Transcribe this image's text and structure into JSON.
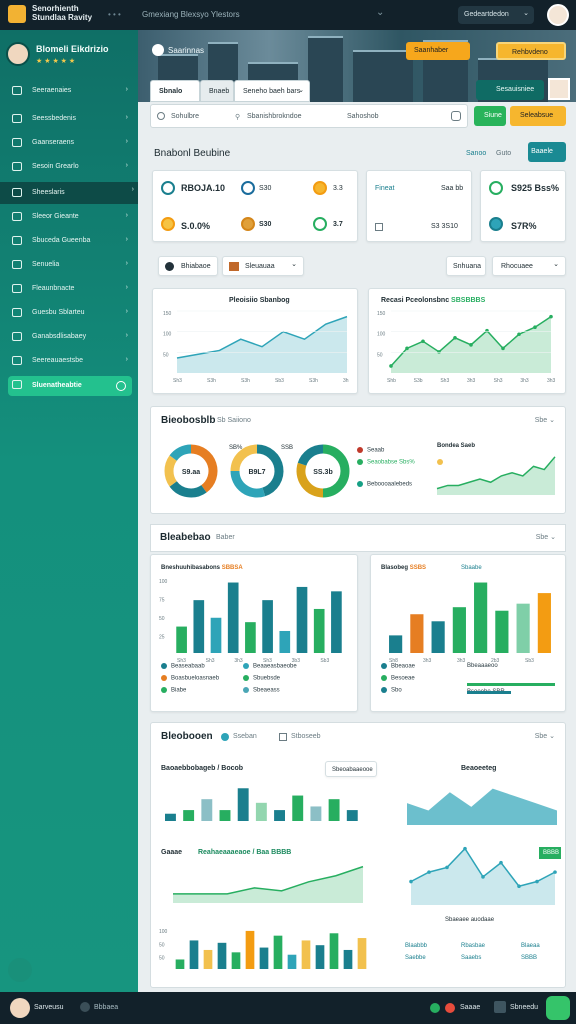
{
  "topbar": {
    "brand_line1": "Senorhienth",
    "brand_line2": "Stundlaa Ravity",
    "dots": "• • •",
    "nav_text": "Gmexiang Blexsyo Ylestors",
    "select_value": "Gedeartdedon",
    "chevron": "⌄"
  },
  "sidebar": {
    "profile_name": "Blomeli Eikdrizio",
    "profile_stars": "★ ★ ★ ★ ★",
    "items": [
      {
        "label": "Seeraenaies"
      },
      {
        "label": "Seessbedenis"
      },
      {
        "label": "Gaanseraens"
      },
      {
        "label": "Sesoin Grearlo"
      },
      {
        "label": "Sheeslaris"
      },
      {
        "label": "Sleeor Gieante"
      },
      {
        "label": "Sbuceda Gueenba"
      },
      {
        "label": "Senuelia"
      },
      {
        "label": "Fleaunbnacte"
      },
      {
        "label": "Guesbu Sblarteu"
      },
      {
        "label": "Ganabsdlisabaey"
      },
      {
        "label": "Seereauaestsbe"
      },
      {
        "label": "Sluenatheabtie"
      }
    ]
  },
  "hero": {
    "title": "Saarinnas",
    "btn1": "Saanhaber",
    "btn2": "Rehbvdeno",
    "btn3": "Sesauisniee"
  },
  "tabs": [
    {
      "label": "Sbnalo"
    },
    {
      "label": "Bnaeb"
    },
    {
      "label": "Seneho baeh bars"
    }
  ],
  "filters": {
    "f1": "Sohulbre",
    "f2": "Sbanishbrokndoe",
    "f3": "Sahoshob",
    "btn_green": "Siune",
    "btn_orange": "Seleabsue"
  },
  "overview": {
    "title": "Bnabonl Beubine",
    "links": [
      "Sanoo",
      "Guto"
    ],
    "button": "Baaele"
  },
  "kpis": [
    {
      "value": "RBOJA.10",
      "tag": "S30",
      "v2": "3.3"
    },
    {
      "value": "S.0.0%",
      "tag": "S30",
      "v2": "3.7"
    }
  ],
  "kpi_card2": {
    "label": "Fineat",
    "v1": "Saa bb",
    "v2": "S3 3S10"
  },
  "kpi_card3": {
    "v1": "S925 Bss%",
    "v2": "S7R%"
  },
  "controls": {
    "c1": "Bhiabaoe",
    "c2": "Sleuauaa",
    "c3": "Snhuana",
    "c4": "Rhocuaee"
  },
  "line_panel_left": {
    "title": "Pleoisiio Sbanbog"
  },
  "line_panel_right": {
    "title": "Recasi Pceolonsbnc",
    "accent": "SBSBBBS"
  },
  "section_donuts": {
    "title": "Bieobosblb",
    "sub": "Sb Saiiono",
    "dd": "Sbe ⌄",
    "donuts": [
      {
        "label": "S9.aa"
      },
      {
        "label": "B9L7"
      },
      {
        "label": "SS.3b"
      }
    ],
    "tags": [
      "SB%",
      "SSB"
    ],
    "legend": [
      {
        "label": "Seaab",
        "color": "#c0392b"
      },
      {
        "label": "Seaobabse Sbs%",
        "color": "#27ae60"
      },
      {
        "label": "Beboooaalebeds",
        "color": "#16a085"
      }
    ],
    "minichart_title": "Bondea Saeb"
  },
  "section_bars": {
    "title": "Bleabebao",
    "sub": "Baber",
    "dd": "Sbe ⌄",
    "left_title": "Bneshuuhibasabons",
    "left_accent": "SBBSA",
    "right_title": "Blasobeg",
    "right_accent": "SSBS",
    "right_tag": "Sbaabe",
    "legend_left": [
      {
        "label": "Beaseabaab",
        "color": "#1a7f8e"
      },
      {
        "label": "Boasbueloasnaeb",
        "color": "#e67e22"
      },
      {
        "label": "Biabe",
        "color": "#27ae60"
      },
      {
        "label": "Beaaeasbaeobe",
        "color": "#2ea4b8"
      },
      {
        "label": "Sbuebsde",
        "color": "#27ae60"
      },
      {
        "label": "Sbeaeass",
        "color": "#4aa6b5"
      }
    ],
    "legend_right": [
      {
        "label": "Bbeaoae",
        "color": "#1a7f8e"
      },
      {
        "label": "Besoeae",
        "color": "#27ae60"
      },
      {
        "label": "Sbo",
        "color": "#1a7f8e"
      },
      {
        "label": "Bbeaaaeoo",
        "color": "#1a7f8e"
      },
      {
        "label": "Bsoeebe SBR",
        "color": "#1a7f8e"
      }
    ]
  },
  "section_bottom": {
    "title": "Bleobooen",
    "sub1": "Sseban",
    "sub2": "Stboseeb",
    "dd": "Sbe ⌄",
    "tl_title": "Baoaebbobageb",
    "tl_sub": "Bocob",
    "tl_btn": "Sbeoabaaeooe",
    "tr_title": "Beaoeeteg",
    "ml_title": "Gaaae",
    "ml_accent": "Reahaeaaaeaoe / Baa BBBB",
    "mr_tag": "BBBB",
    "mr_caption": "Sbaeaee auodaae",
    "mr_vals": [
      "Blaabbb",
      "Rbasbae",
      "Blaeaa",
      "Saebbe",
      "Saaebs",
      "SBBB"
    ]
  },
  "bottombar": {
    "name": "Sarveusu",
    "label": "Bbbaea",
    "label2": "Saaae",
    "label3": "Sbneedu"
  },
  "chart_data": [
    {
      "type": "area",
      "title": "Pleoisiio Sbanbog",
      "x": [
        "Sh3",
        "S3h",
        "S3h",
        "Sb3",
        "S3h",
        "3h"
      ],
      "values": [
        4,
        5,
        6,
        9,
        7,
        11,
        9,
        13,
        15
      ],
      "yticks": [
        "150",
        "100",
        "50"
      ],
      "color": "#2ea4b8"
    },
    {
      "type": "area",
      "title": "Recasi Pceolonsbnc",
      "x": [
        "Shb",
        "S3b",
        "Sh3",
        "3h3",
        "Sh3",
        "3h3",
        "3h3"
      ],
      "values": [
        2,
        7,
        9,
        6,
        10,
        8,
        12,
        7,
        11,
        13,
        16
      ],
      "yticks": [
        "150",
        "100",
        "50"
      ],
      "color": "#27ae60"
    },
    {
      "type": "pie",
      "values": [
        40,
        25,
        20,
        15
      ],
      "colors": [
        "#e67e22",
        "#1a7f8e",
        "#f2c14e",
        "#2ea4b8"
      ]
    },
    {
      "type": "pie",
      "values": [
        45,
        30,
        25
      ],
      "colors": [
        "#1a7f8e",
        "#2ea4b8",
        "#f2c14e"
      ]
    },
    {
      "type": "pie",
      "values": [
        50,
        30,
        20
      ],
      "colors": [
        "#27ae60",
        "#d9a21b",
        "#1a7f8e"
      ]
    },
    {
      "type": "area",
      "values": [
        2,
        3,
        3,
        4,
        5,
        4,
        6,
        7,
        6,
        9,
        8,
        12
      ],
      "color": "#27ae60"
    },
    {
      "type": "bar",
      "categories": [
        "Sh3",
        "Sh3",
        "3h3",
        "Sh3",
        "3b3",
        "Sb3"
      ],
      "values": [
        30,
        60,
        40,
        80,
        35,
        60,
        25,
        75,
        50,
        70
      ],
      "colors": [
        "#27ae60",
        "#1a7f8e",
        "#2ea4b8",
        "#1a7f8e",
        "#27ae60",
        "#1a7f8e",
        "#2ea4b8",
        "#1a7f8e",
        "#27ae60",
        "#1a7f8e"
      ],
      "yticks": [
        "100",
        "75",
        "50",
        "25"
      ]
    },
    {
      "type": "bar",
      "categories": [
        "Sh8",
        "3h3",
        "3h3",
        "2b3",
        "Sb3"
      ],
      "values": [
        25,
        55,
        45,
        65,
        100,
        60,
        70,
        85
      ],
      "colors": [
        "#1a7f8e",
        "#e67e22",
        "#1a7f8e",
        "#27ae60",
        "#27ae60",
        "#27ae60",
        "#7fcfa8",
        "#f39c12"
      ]
    },
    {
      "type": "area",
      "values": [
        2,
        3,
        6,
        3,
        9,
        5,
        3,
        7,
        4,
        6,
        3
      ],
      "colors": [
        "#1a7f8e",
        "#27ae60"
      ]
    },
    {
      "type": "area",
      "values": [
        6,
        4,
        9,
        5,
        10,
        8,
        6,
        4
      ],
      "color": "#2ea4b8"
    },
    {
      "type": "line",
      "values": [
        3,
        3,
        3,
        5,
        4,
        7,
        9,
        12
      ],
      "color": "#27ae60"
    },
    {
      "type": "line",
      "values": [
        5,
        7,
        8,
        12,
        6,
        9,
        4,
        5,
        7
      ],
      "color": "#2ea4b8"
    },
    {
      "type": "bar",
      "values": [
        20,
        60,
        40,
        55,
        35,
        80,
        45,
        70,
        30,
        60,
        50,
        75,
        40,
        65
      ],
      "colors": [
        "#27ae60",
        "#1a7f8e",
        "#f2c14e",
        "#1a7f8e",
        "#27ae60",
        "#f39c12",
        "#1a7f8e",
        "#27ae60",
        "#2ea4b8",
        "#f2c14e",
        "#1a7f8e",
        "#27ae60",
        "#1a7f8e",
        "#f2c14e"
      ],
      "yticks": [
        "100",
        "50",
        "50"
      ]
    }
  ]
}
